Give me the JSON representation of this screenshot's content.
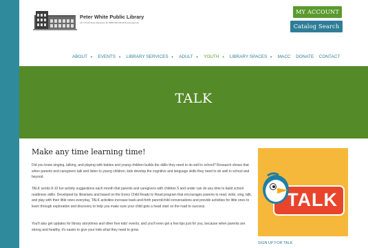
{
  "header": {
    "logo_title": "Peter White Public Library",
    "logo_subtitle": "217 N Front Street Marquette, MI 49855 906.228.9510 www.pwpl.info",
    "my_account": "MY ACCOUNT",
    "catalog_search": "Catalog Search"
  },
  "nav": {
    "items": [
      {
        "label": "ABOUT"
      },
      {
        "label": "EVENTS"
      },
      {
        "label": "LIBRARY SERVICES"
      },
      {
        "label": "ADULT"
      },
      {
        "label": "YOUTH"
      },
      {
        "label": "LIBRARY SPACES"
      },
      {
        "label": "MACC"
      },
      {
        "label": "DONATE"
      },
      {
        "label": "CONTACT"
      }
    ]
  },
  "hero": {
    "title": "TALK"
  },
  "main": {
    "heading": "Make any time learning time!",
    "paragraphs": [
      "Did you know singing, talking, and playing with babies and young children builds the skills they need to do well in school? Research shows that when parents and caregivers talk and listen to young children, kids develop the cognitive and language skills they need to do well in school and beyond.",
      "TALK sends 8-10 fun activity suggestions each month that parents and caregivers with children 5 and under can do any time to build school readiness skills. Developed by librarians and based on the Every Child Ready to Read program that encourages parents to read, write, sing, talk, and play with their little ones everyday, TALK activities increase back-and-forth parent/child conversations and provide activities for little ones to learn through exploration and discovery to help you make sure your child gets a head start on the road to success.",
      "You'll also get updates for library storytimes and other free kids' events; and you'll even get a few tips just for you, because when parents are strong and healthy, it's easier to give your kids what they need to grow."
    ]
  },
  "sidebar": {
    "promo_text": "TALK",
    "signup_link": "SIGN UP FOR TALK"
  },
  "colors": {
    "green": "#548a28",
    "teal": "#2f7d98",
    "promo_yellow": "#f5b83a",
    "talk_red": "#e8452c"
  }
}
